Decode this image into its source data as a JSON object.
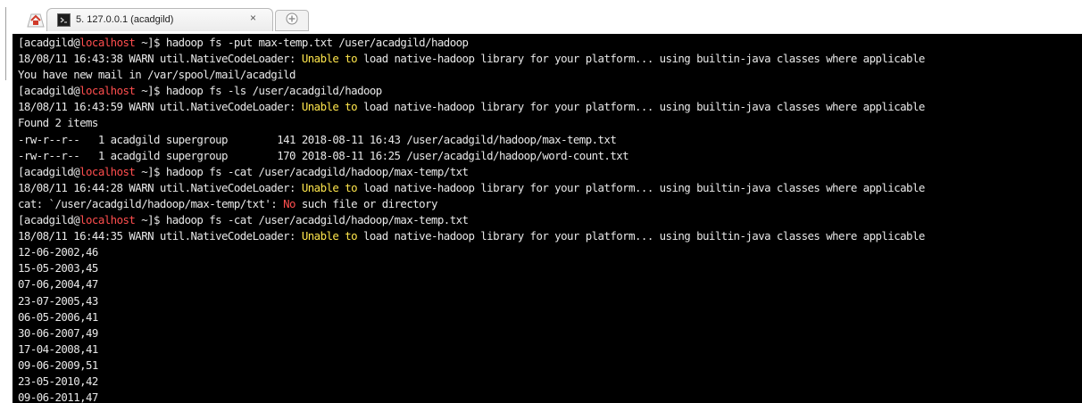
{
  "window": {
    "tab_title": "5. 127.0.0.1 (acadgild)",
    "tab_close_glyph": "×",
    "icons": [
      "home-icon",
      "terminal-icon",
      "close-icon",
      "new-tab-icon"
    ]
  },
  "colors": {
    "terminal_bg": "#000000",
    "text": "#e8e8e8",
    "highlight_yellow": "#ffe64c",
    "highlight_red": "#ff4e4e"
  },
  "terminal": {
    "lines": [
      [
        {
          "t": "[acadgild@"
        },
        {
          "t": "localhost",
          "c": "red"
        },
        {
          "t": " ~]$ hadoop fs -put max-temp.txt /user/acadgild/hadoop"
        }
      ],
      [
        {
          "t": "18/08/11 16:43:38 WARN util.NativeCodeLoader: "
        },
        {
          "t": "Unable to",
          "c": "yel"
        },
        {
          "t": " load native-hadoop library for your platform... using builtin-java classes where applicable"
        }
      ],
      [
        {
          "t": "You have new mail in /var/spool/mail/acadgild"
        }
      ],
      [
        {
          "t": "[acadgild@"
        },
        {
          "t": "localhost",
          "c": "red"
        },
        {
          "t": " ~]$ hadoop fs -ls /user/acadgild/hadoop"
        }
      ],
      [
        {
          "t": "18/08/11 16:43:59 WARN util.NativeCodeLoader: "
        },
        {
          "t": "Unable to",
          "c": "yel"
        },
        {
          "t": " load native-hadoop library for your platform... using builtin-java classes where applicable"
        }
      ],
      [
        {
          "t": "Found 2 items"
        }
      ],
      [
        {
          "t": "-rw-r--r--   1 acadgild supergroup        141 2018-08-11 16:43 /user/acadgild/hadoop/max-temp.txt"
        }
      ],
      [
        {
          "t": "-rw-r--r--   1 acadgild supergroup        170 2018-08-11 16:25 /user/acadgild/hadoop/word-count.txt"
        }
      ],
      [
        {
          "t": "[acadgild@"
        },
        {
          "t": "localhost",
          "c": "red"
        },
        {
          "t": " ~]$ hadoop fs -cat /user/acadgild/hadoop/max-temp/txt"
        }
      ],
      [
        {
          "t": "18/08/11 16:44:28 WARN util.NativeCodeLoader: "
        },
        {
          "t": "Unable to",
          "c": "yel"
        },
        {
          "t": " load native-hadoop library for your platform... using builtin-java classes where applicable"
        }
      ],
      [
        {
          "t": "cat: `/user/acadgild/hadoop/max-temp/txt': "
        },
        {
          "t": "No",
          "c": "red"
        },
        {
          "t": " such file or directory"
        }
      ],
      [
        {
          "t": "[acadgild@"
        },
        {
          "t": "localhost",
          "c": "red"
        },
        {
          "t": " ~]$ hadoop fs -cat /user/acadgild/hadoop/max-temp.txt"
        }
      ],
      [
        {
          "t": "18/08/11 16:44:35 WARN util.NativeCodeLoader: "
        },
        {
          "t": "Unable to",
          "c": "yel"
        },
        {
          "t": " load native-hadoop library for your platform... using builtin-java classes where applicable"
        }
      ],
      [
        {
          "t": "12-06-2002,46"
        }
      ],
      [
        {
          "t": "15-05-2003,45"
        }
      ],
      [
        {
          "t": "07-06,2004,47"
        }
      ],
      [
        {
          "t": "23-07-2005,43"
        }
      ],
      [
        {
          "t": "06-05-2006,41"
        }
      ],
      [
        {
          "t": "30-06-2007,49"
        }
      ],
      [
        {
          "t": "17-04-2008,41"
        }
      ],
      [
        {
          "t": "09-06-2009,51"
        }
      ],
      [
        {
          "t": "23-05-2010,42"
        }
      ],
      [
        {
          "t": "09-06-2011,47"
        }
      ]
    ]
  }
}
